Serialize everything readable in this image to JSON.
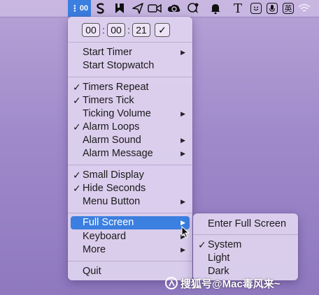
{
  "menubar": {
    "active_item": {
      "dots": "⋮",
      "label": "00"
    },
    "icons": [
      "s-logo-icon",
      "bookmark-app-icon",
      "send-icon",
      "video-camera-icon",
      "creative-cloud-icon",
      "chat-bubble-icon",
      "bell-icon",
      "text-tool-icon",
      "face-icon",
      "microphone-icon",
      "input-method-icon",
      "wifi-icon"
    ],
    "text_glyph": "T",
    "input_method_label": "英"
  },
  "timer": {
    "hours": "00",
    "minutes": "00",
    "seconds": "21",
    "separator": ":",
    "confirm": "✓"
  },
  "menu": {
    "start_timer": "Start Timer",
    "start_stopwatch": "Start Stopwatch",
    "timers_repeat": "Timers Repeat",
    "timers_tick": "Timers Tick",
    "ticking_volume": "Ticking Volume",
    "alarm_loops": "Alarm Loops",
    "alarm_sound": "Alarm Sound",
    "alarm_message": "Alarm Message",
    "small_display": "Small Display",
    "hide_seconds": "Hide Seconds",
    "menu_button": "Menu Button",
    "full_screen": "Full Screen",
    "keyboard": "Keyboard",
    "more": "More",
    "quit": "Quit",
    "check_mark": "✓",
    "submenu_arrow": "▶"
  },
  "submenu": {
    "enter_full_screen": "Enter Full Screen",
    "system": "System",
    "light": "Light",
    "dark": "Dark",
    "check_mark": "✓"
  },
  "watermark": {
    "text": "搜狐号@Mac毒风来~"
  },
  "colors": {
    "highlight": "#3b7fe0",
    "menu_background": "#e0d4f0",
    "desktop": "#a08acb"
  }
}
